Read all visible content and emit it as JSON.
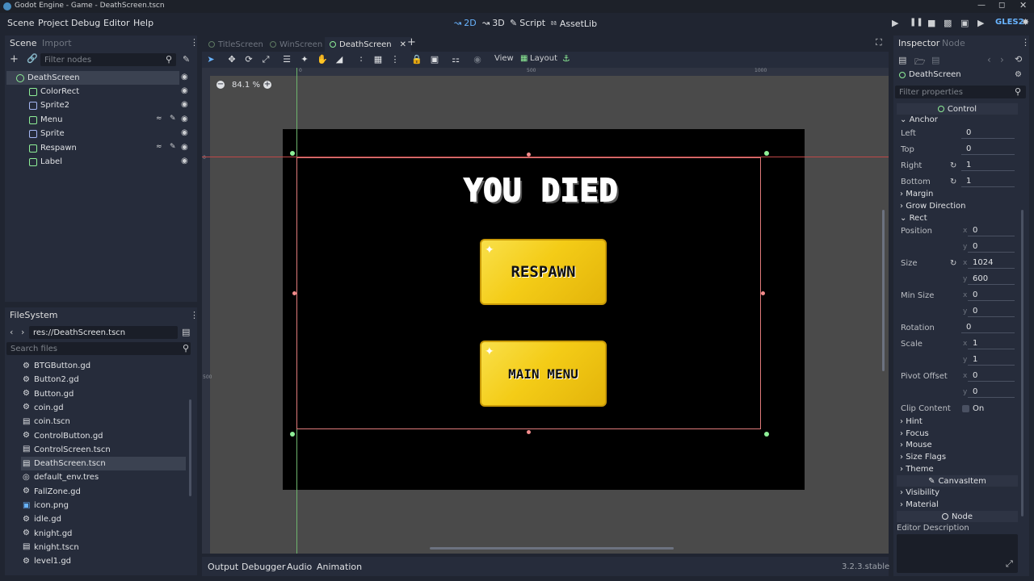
{
  "window": {
    "title": "Godot Engine - Game - DeathScreen.tscn"
  },
  "menu": {
    "items": [
      "Scene",
      "Project",
      "Debug",
      "Editor",
      "Help"
    ]
  },
  "workspaces": {
    "w2d": "2D",
    "w3d": "3D",
    "script": "Script",
    "assetlib": "AssetLib"
  },
  "renderer": "GLES2",
  "scene_dock": {
    "tab_scene": "Scene",
    "tab_import": "Import",
    "filter_placeholder": "Filter nodes",
    "nodes": [
      {
        "name": "DeathScreen",
        "icon_color": "#8eef97"
      },
      {
        "name": "ColorRect",
        "icon_color": "#8eef97"
      },
      {
        "name": "Sprite2",
        "icon_color": "#a5b7f3"
      },
      {
        "name": "Menu",
        "icon_color": "#8eef97"
      },
      {
        "name": "Sprite",
        "icon_color": "#a5b7f3"
      },
      {
        "name": "Respawn",
        "icon_color": "#8eef97"
      },
      {
        "name": "Label",
        "icon_color": "#8eef97"
      }
    ]
  },
  "filesystem": {
    "tab": "FileSystem",
    "path": "res://DeathScreen.tscn",
    "search_placeholder": "Search files",
    "files": [
      {
        "name": "BTGButton.gd",
        "icon": "gear-icon"
      },
      {
        "name": "Button2.gd",
        "icon": "gear-icon"
      },
      {
        "name": "Button.gd",
        "icon": "gear-icon"
      },
      {
        "name": "coin.gd",
        "icon": "gear-icon"
      },
      {
        "name": "coin.tscn",
        "icon": "clapper-icon"
      },
      {
        "name": "ControlButton.gd",
        "icon": "gear-icon"
      },
      {
        "name": "ControlScreen.tscn",
        "icon": "clapper-icon"
      },
      {
        "name": "DeathScreen.tscn",
        "icon": "clapper-icon"
      },
      {
        "name": "default_env.tres",
        "icon": "globe-icon"
      },
      {
        "name": "FallZone.gd",
        "icon": "gear-icon"
      },
      {
        "name": "icon.png",
        "icon": "image-icon"
      },
      {
        "name": "idle.gd",
        "icon": "gear-icon"
      },
      {
        "name": "knight.gd",
        "icon": "gear-icon"
      },
      {
        "name": "knight.tscn",
        "icon": "clapper-icon"
      },
      {
        "name": "level1.gd",
        "icon": "gear-icon"
      }
    ]
  },
  "editor_tabs": [
    "TitleScreen",
    "WinScreen",
    "DeathScreen"
  ],
  "toolbar": {
    "view": "View",
    "layout": "Layout"
  },
  "viewport": {
    "zoom": "84.1 %",
    "ruler_marks": [
      "0",
      "500",
      "1000"
    ],
    "ruler_v_marks": [
      "0",
      "500"
    ],
    "game_title": "YOU DIED",
    "respawn_button": "RESPAWN",
    "main_menu_button": "MAIN MENU"
  },
  "bottom_panel": {
    "tabs": [
      "Output",
      "Debugger",
      "Audio",
      "Animation"
    ],
    "version": "3.2.3.stable"
  },
  "inspector": {
    "tab_inspector": "Inspector",
    "tab_node": "Node",
    "node_name": "DeathScreen",
    "filter_placeholder": "Filter properties",
    "section_control": "Control",
    "anchor": "Anchor",
    "left_label": "Left",
    "left_val": "0",
    "top_label": "Top",
    "top_val": "0",
    "right_label": "Right",
    "right_val": "1",
    "bottom_label": "Bottom",
    "bottom_val": "1",
    "margin": "Margin",
    "grow": "Grow Direction",
    "rect": "Rect",
    "position_label": "Position",
    "position_x": "0",
    "position_y": "0",
    "size_label": "Size",
    "size_x": "1024",
    "size_y": "600",
    "minsize_label": "Min Size",
    "minsize_x": "0",
    "minsize_y": "0",
    "rotation_label": "Rotation",
    "rotation_val": "0",
    "scale_label": "Scale",
    "scale_x": "1",
    "scale_y": "1",
    "pivot_label": "Pivot Offset",
    "pivot_x": "0",
    "pivot_y": "0",
    "clip_label": "Clip Content",
    "clip_val": "On",
    "hint": "Hint",
    "focus": "Focus",
    "mouse": "Mouse",
    "size_flags": "Size Flags",
    "theme": "Theme",
    "section_canvas": "CanvasItem",
    "visibility": "Visibility",
    "material": "Material",
    "section_node": "Node",
    "editor_desc": "Editor Description",
    "axis_x": "x",
    "axis_y": "y"
  },
  "colors": {
    "accent": "#69b4ff",
    "control_green": "#8eef97",
    "button_yellow": "#f4cc17",
    "selection_red": "#e07b7b"
  }
}
